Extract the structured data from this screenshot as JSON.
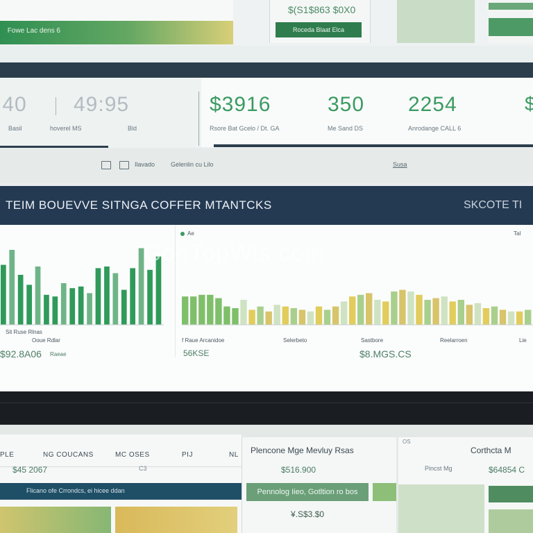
{
  "top_cards": {
    "card_a_label": " Fowe Lac dens 6",
    "card_b_amount": "$(S1$863 $0X0",
    "card_b_button": "Roceda Blaat Elca"
  },
  "kpis": [
    {
      "value": ":40",
      "label": "Basil",
      "color": "#b2bcc1"
    },
    {
      "value": "49:95",
      "label": "hoverel  MS",
      "color": "#b2bcc1"
    },
    {
      "value": "$3916",
      "label": "Rsore Bat Gcelo / Dt. GA",
      "color": "#3a9a62"
    },
    {
      "value": "350",
      "label": "Me Sand  DS",
      "color": "#3a9a62"
    },
    {
      "value": "2254",
      "label": "Anrodange CALL 6",
      "color": "#3a9a62"
    }
  ],
  "kpi_extra_label": "Bld",
  "toolbar": {
    "items": [
      "Ilavado",
      "Gelenlin cu  Lilo"
    ],
    "right_label": "Susa"
  },
  "title_bar": {
    "title": "TEIM BOUEVVE SITNGA COFFER MTANTCKS",
    "right": "SKCOTE TI"
  },
  "chart_panel": {
    "legend_left": "Ae",
    "legend_right": "Tal",
    "left_axis_labels": [
      "Sit Ruse Rlnas",
      "Ooue Rdlar"
    ],
    "mid_axis_labels": [
      "f Raue Arcanidoe",
      "Selerbeto",
      "Sastbore",
      "Reelarroen",
      "Lie"
    ],
    "value_left": "$92.8A06",
    "value_left_note": "Raeae",
    "value_mid": "56KSE",
    "value_right": "$8.MGS.CS",
    "watermark": "GonTopWis.com"
  },
  "chart_data": {
    "type": "bar",
    "series": [
      {
        "name": "",
        "values": [
          72,
          90,
          60,
          48,
          70,
          36,
          34,
          50,
          44,
          46,
          38,
          68,
          70,
          62,
          42,
          68,
          92,
          66,
          82
        ]
      },
      {
        "name": "",
        "values": [
          34,
          34,
          36,
          36,
          32,
          22,
          20,
          30,
          18,
          22,
          16,
          24,
          22,
          20,
          18,
          16,
          22,
          18,
          22,
          28,
          34,
          36,
          38,
          30,
          28,
          40,
          42,
          40,
          36,
          30,
          32,
          34,
          28,
          30,
          24,
          26,
          20,
          22,
          18,
          16,
          16,
          18
        ]
      }
    ]
  },
  "bottom": {
    "tabs": [
      "PLE",
      "NG COUCANS",
      "MC OSES",
      "PIJ",
      "NL"
    ],
    "amount": "$45 2067",
    "amount_note": "C3",
    "navy_text": "Flicano ofe  Crrondcs, ei hicee ddan",
    "card2_head": "Plencone Mge Mevluy Rsas",
    "card2_amount": "$516.900",
    "card2_button": "Pennolog Iieo, Gotltion ro bos",
    "card2_amount2": "¥.S$3.$0",
    "card3_tiny": "OS",
    "card3_head": "Corthcta  M",
    "card3_sub": "Pincst  Mg",
    "card3_amount": "$64854 C"
  }
}
